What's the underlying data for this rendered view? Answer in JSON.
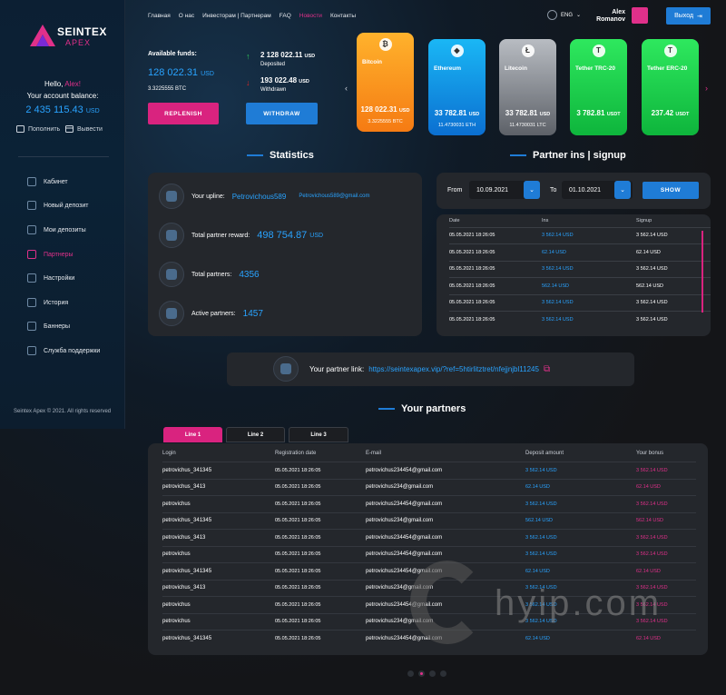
{
  "brand": {
    "line1": "SEINTEX",
    "line2": "APEX"
  },
  "sidebar": {
    "hello": "Hello,",
    "user": "Alex!",
    "balance_label": "Your account balance:",
    "balance": "2 435 115.43",
    "balance_cur": "USD",
    "topup": "Пополнить",
    "withdraw": "Вывести",
    "items": [
      {
        "label": "Кабинет"
      },
      {
        "label": "Новый депозит"
      },
      {
        "label": "Мои депозиты"
      },
      {
        "label": "Партнеры"
      },
      {
        "label": "Настройки"
      },
      {
        "label": "История"
      },
      {
        "label": "Баннеры"
      },
      {
        "label": "Служба поддержки"
      }
    ],
    "copyright": "Seintex Apex © 2021. All rights reserved"
  },
  "header": {
    "nav": [
      "Главная",
      "О нас",
      "Инвесторам | Партнерам",
      "FAQ",
      "Новости",
      "Контакты"
    ],
    "lang": "ENG",
    "user_first": "Alex",
    "user_last": "Romanov",
    "exit": "Выход"
  },
  "funds": {
    "label": "Available funds:",
    "value": "128 022.31",
    "cur": "USD",
    "btc": "3.3225555 BTC",
    "replenish": "REPLENISH",
    "deposited": "2 128 022.11",
    "deposited_cur": "USD",
    "deposited_label": "Deposited",
    "withdrawn": "193 022.48",
    "withdrawn_cur": "USD",
    "withdrawn_label": "Withdrawn",
    "withdraw": "WITHDRAW"
  },
  "cards": [
    {
      "name": "Bitcoin",
      "icon": "₿",
      "value": "128 022.31",
      "cur": "USD",
      "sub": "3.3225555 BTC"
    },
    {
      "name": "Ethereum",
      "icon": "◆",
      "value": "33 782.81",
      "cur": "USD",
      "sub": "11.4730031 ETH"
    },
    {
      "name": "Litecoin",
      "icon": "Ł",
      "value": "33 782.81",
      "cur": "USD",
      "sub": "11.4730031 LTC"
    },
    {
      "name": "Tether TRC-20",
      "icon": "T",
      "value": "3 782.81",
      "cur": "USDT",
      "sub": ""
    },
    {
      "name": "Tether ERC-20",
      "icon": "T",
      "value": "237.42",
      "cur": "USDT",
      "sub": ""
    }
  ],
  "stats": {
    "title": "Statistics",
    "upline_label": "Your upline:",
    "upline": "Petrovichous589",
    "upline_email": "Petrovichous589@gmail.com",
    "reward_label": "Total partner reward:",
    "reward": "498 754.87",
    "reward_cur": "USD",
    "partners_label": "Total partners:",
    "partners": "4356",
    "active_label": "Active partners:",
    "active": "1457"
  },
  "signup": {
    "title": "Partner ins | signup",
    "from_label": "From",
    "from": "10.09.2021",
    "to_label": "To",
    "to": "01.10.2021",
    "show": "SHOW",
    "headers": [
      "Date",
      "Ins",
      "Signup"
    ],
    "rows": [
      [
        "05.05.2021 18:26:05",
        "3 562.14 USD",
        "3 562.14 USD"
      ],
      [
        "05.05.2021 18:26:05",
        "62.14 USD",
        "62.14 USD"
      ],
      [
        "05.05.2021 18:26:05",
        "3 562.14 USD",
        "3 562.14 USD"
      ],
      [
        "05.05.2021 18:26:05",
        "562.14 USD",
        "562.14 USD"
      ],
      [
        "05.05.2021 18:26:05",
        "3 562.14 USD",
        "3 562.14 USD"
      ],
      [
        "05.05.2021 18:26:05",
        "3 562.14 USD",
        "3 562.14 USD"
      ]
    ]
  },
  "link": {
    "label": "Your partner link:",
    "url": "https://seintexapex.vip/?ref=5htirlitztret/nfejjnjbl11245"
  },
  "partners": {
    "title": "Your partners",
    "tabs": [
      "Line 1",
      "Line 2",
      "Line 3"
    ],
    "headers": [
      "Login",
      "Registration date",
      "E-mail",
      "Deposit amount",
      "Your bonus"
    ],
    "rows": [
      [
        "petrovichus_341345",
        "05.05.2021 18:26:05",
        "petrovichus234454@gmail.com",
        "3 562.14 USD",
        "3 562.14 USD"
      ],
      [
        "petrovichus_3413",
        "05.05.2021 18:26:05",
        "petrovichus234@gmail.com",
        "62.14 USD",
        "62.14 USD"
      ],
      [
        "petrovichus",
        "05.05.2021 18:26:05",
        "petrovichus234454@gmail.com",
        "3 562.14 USD",
        "3 562.14 USD"
      ],
      [
        "petrovichus_341345",
        "05.05.2021 18:26:05",
        "petrovichus234@gmail.com",
        "562.14 USD",
        "562.14 USD"
      ],
      [
        "petrovichus_3413",
        "05.05.2021 18:26:05",
        "petrovichus234454@gmail.com",
        "3 562.14 USD",
        "3 562.14 USD"
      ],
      [
        "petrovichus",
        "05.05.2021 18:26:05",
        "petrovichus234454@gmail.com",
        "3 562.14 USD",
        "3 562.14 USD"
      ],
      [
        "petrovichus_341345",
        "05.05.2021 18:26:05",
        "petrovichus234454@gmail.com",
        "62.14 USD",
        "62.14 USD"
      ],
      [
        "petrovichus_3413",
        "05.05.2021 18:26:05",
        "petrovichus234@gmail.com",
        "3 562.14 USD",
        "3 562.14 USD"
      ],
      [
        "petrovichus",
        "05.05.2021 18:26:05",
        "petrovichus234454@gmail.com",
        "3 562.14 USD",
        "3 562.14 USD"
      ],
      [
        "petrovichus",
        "05.05.2021 18:26:05",
        "petrovichus234@gmail.com",
        "3 562.14 USD",
        "3 562.14 USD"
      ],
      [
        "petrovichus_341345",
        "05.05.2021 18:26:05",
        "petrovichus234454@gmail.com",
        "62.14 USD",
        "62.14 USD"
      ]
    ]
  },
  "watermark": "hyip.com"
}
